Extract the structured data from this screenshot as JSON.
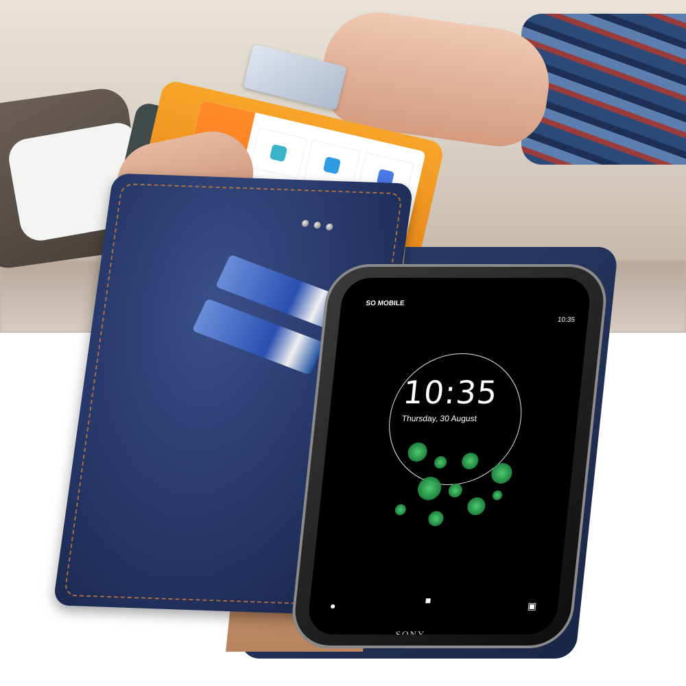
{
  "phone": {
    "carrier": "SO MOBILE",
    "status_time": "10:35",
    "lock_time": "10:35",
    "lock_date": "Thursday, 30 August",
    "brand": "SONY",
    "icons": [
      "mic-icon",
      "lock-icon",
      "camera-icon"
    ]
  },
  "colors": {
    "case_blue": "#27386a",
    "stitch": "#c47a3a",
    "case_inner": "#c89a72",
    "terminal_orange": "#f7a52a",
    "bubble_green": "#2fbf5a"
  }
}
